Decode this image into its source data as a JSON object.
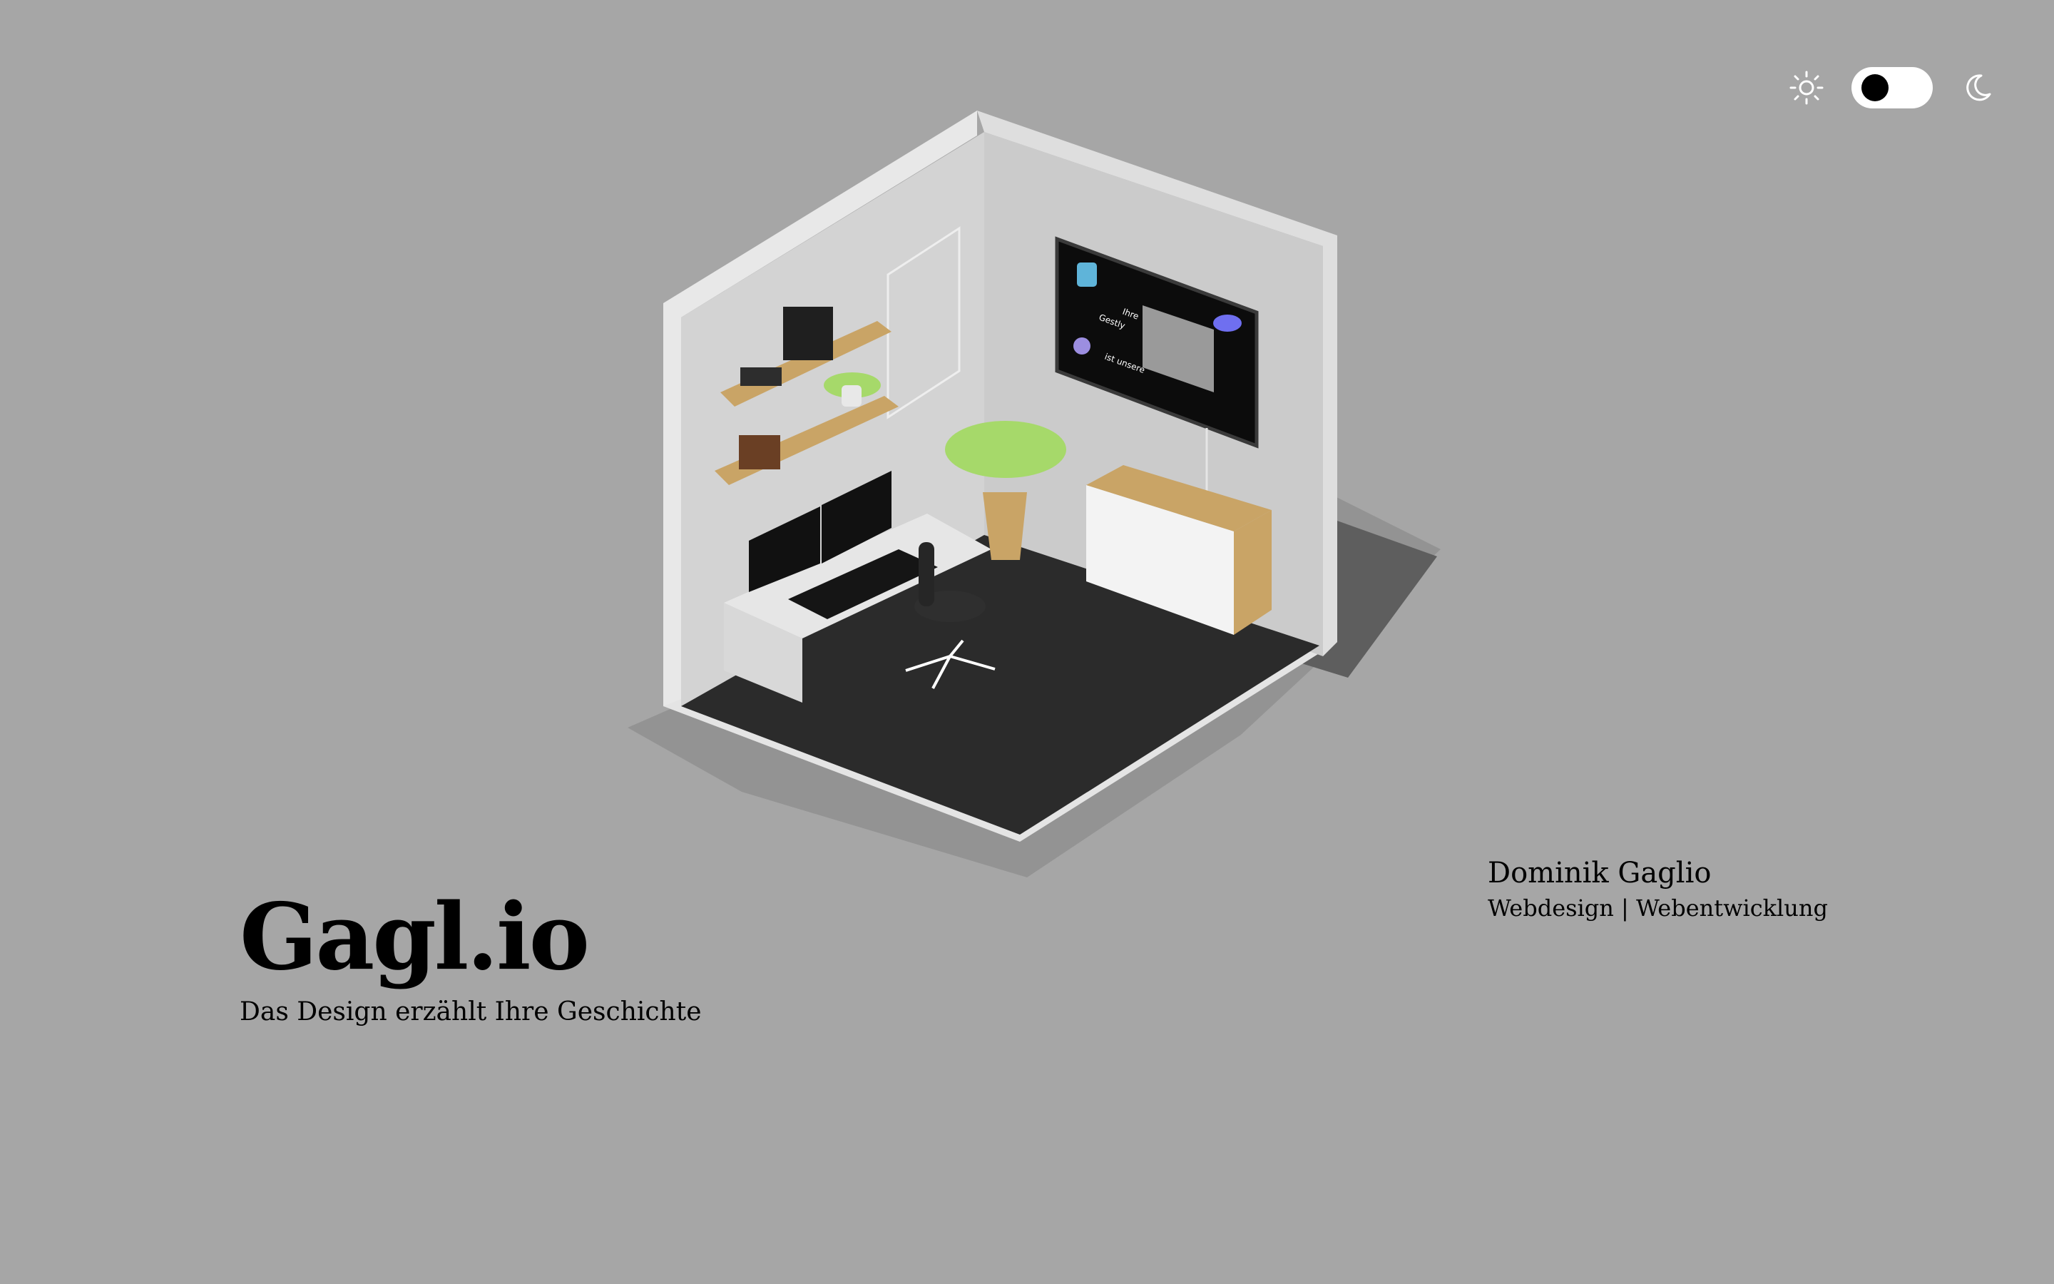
{
  "theme_switch": {
    "light_icon": "sun-icon",
    "dark_icon": "moon-icon",
    "state": "light"
  },
  "scene": {
    "description_icon": "isometric-office-room-illustration",
    "screen_words": [
      "Gestly",
      "Ihre",
      "ist unsere"
    ]
  },
  "brand": {
    "title": "Gagl.io",
    "tagline": "Das Design erzählt Ihre Geschichte"
  },
  "author": {
    "name": "Dominik Gaglio",
    "role": "Webdesign | Webentwicklung"
  },
  "colors": {
    "background": "#a6a6a6",
    "floor": "#2a2a2a",
    "wall_light": "#d6d6d6",
    "wood": "#c9a466"
  }
}
